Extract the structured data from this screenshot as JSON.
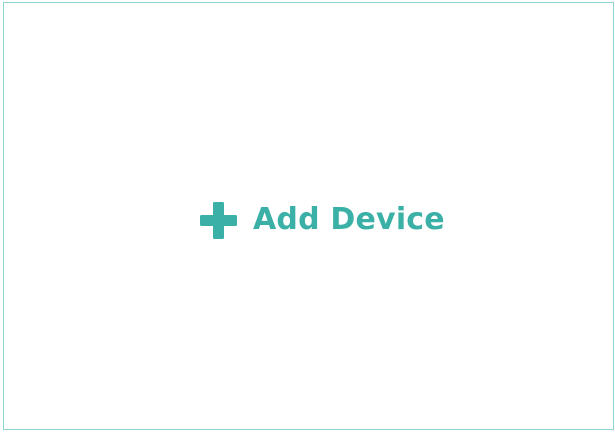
{
  "card": {
    "add_device": {
      "label": "Add Device",
      "icon": "plus-icon"
    }
  },
  "colors": {
    "accent": "#3bb0a6",
    "border": "#8ed3cf",
    "background": "#ffffff"
  }
}
